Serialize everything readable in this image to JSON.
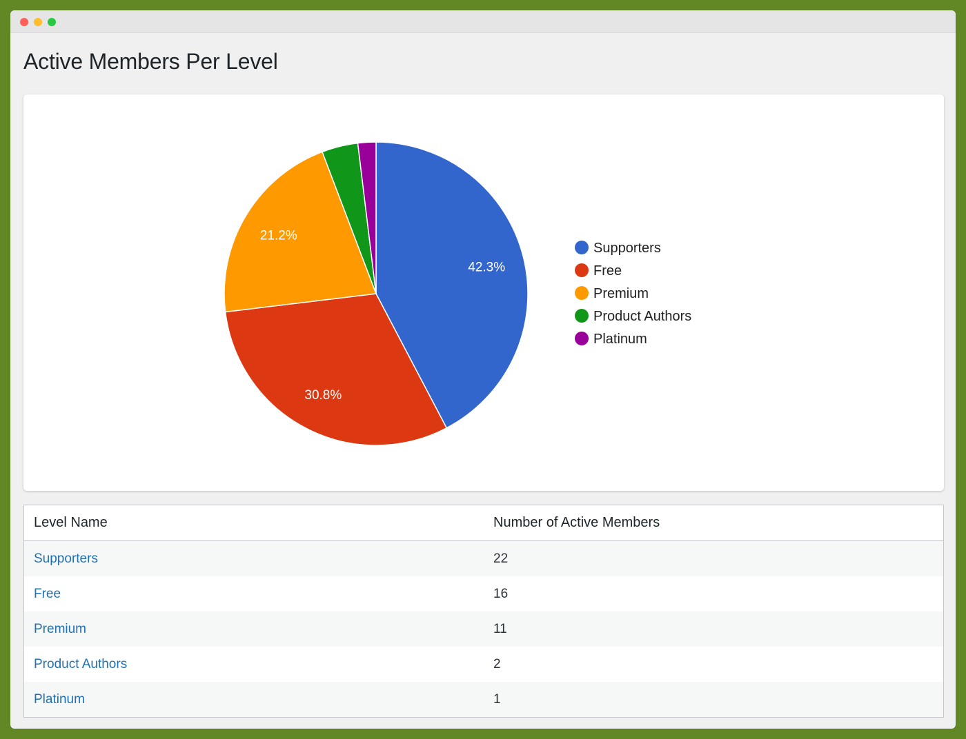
{
  "page": {
    "title": "Active Members Per Level"
  },
  "chart_data": {
    "type": "pie",
    "categories": [
      "Supporters",
      "Free",
      "Premium",
      "Product Authors",
      "Platinum"
    ],
    "values": [
      22,
      16,
      11,
      2,
      1
    ],
    "slice_labels": [
      "42.3%",
      "30.8%",
      "21.2%",
      "",
      ""
    ],
    "colors": [
      "#3366cc",
      "#dc3912",
      "#ff9900",
      "#109618",
      "#990099"
    ],
    "legend_position": "right"
  },
  "table": {
    "headers": {
      "level": "Level Name",
      "count": "Number of Active Members"
    },
    "rows": [
      {
        "level": "Supporters",
        "count": "22"
      },
      {
        "level": "Free",
        "count": "16"
      },
      {
        "level": "Premium",
        "count": "11"
      },
      {
        "level": "Product Authors",
        "count": "2"
      },
      {
        "level": "Platinum",
        "count": "1"
      }
    ]
  }
}
